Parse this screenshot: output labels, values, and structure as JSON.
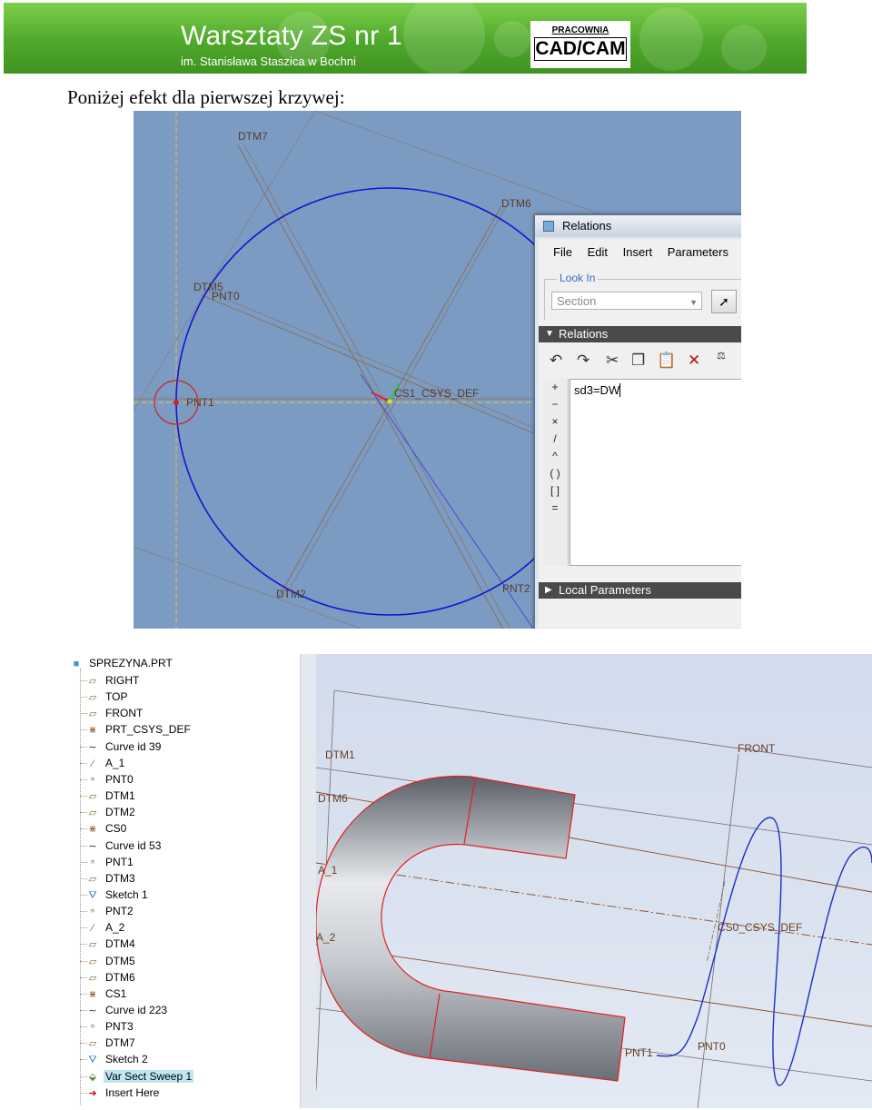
{
  "banner": {
    "title": "Warsztaty ZS nr 1",
    "subtitle": "im. Stanisława Staszica w Bochni",
    "badge_top": "PRACOWNIA",
    "badge_main": "CAD/CAM"
  },
  "caption": "Poniżej efekt dla pierwszej krzywej:",
  "viewport1": {
    "labels": [
      "DTM7",
      "DTM6",
      "DTM5",
      "PNT0",
      "CS1_CSYS_DEF",
      "PNT1",
      "DTM2",
      "PNT2"
    ]
  },
  "relations": {
    "title": "Relations",
    "menu": [
      "File",
      "Edit",
      "Insert",
      "Parameters"
    ],
    "look_in": "Look In",
    "section_placeholder": "Section",
    "relations_header": "Relations",
    "side_ops": [
      "+",
      "−",
      "×",
      "/",
      "^",
      "( )",
      "[ ]",
      "="
    ],
    "expression": "sd3=DW",
    "local_parameters": "Local Parameters",
    "colors": {
      "header": "#4a4a4a",
      "title_bar": "#c8d3e0"
    }
  },
  "model_tree": {
    "root": "SPREZYNA.PRT",
    "items": [
      {
        "label": "RIGHT",
        "icon": "datum-plane-icon"
      },
      {
        "label": "TOP",
        "icon": "datum-plane-icon"
      },
      {
        "label": "FRONT",
        "icon": "datum-plane-icon"
      },
      {
        "label": "PRT_CSYS_DEF",
        "icon": "csys-icon"
      },
      {
        "label": "Curve id 39",
        "icon": "curve-icon"
      },
      {
        "label": "A_1",
        "icon": "axis-icon"
      },
      {
        "label": "PNT0",
        "icon": "datum-point-icon"
      },
      {
        "label": "DTM1",
        "icon": "datum-plane-icon"
      },
      {
        "label": "DTM2",
        "icon": "datum-plane-icon"
      },
      {
        "label": "CS0",
        "icon": "csys-icon"
      },
      {
        "label": "Curve id 53",
        "icon": "curve-icon"
      },
      {
        "label": "PNT1",
        "icon": "datum-point-icon"
      },
      {
        "label": "DTM3",
        "icon": "datum-plane-icon"
      },
      {
        "label": "Sketch 1",
        "icon": "sketch-icon"
      },
      {
        "label": "PNT2",
        "icon": "datum-point-icon"
      },
      {
        "label": "A_2",
        "icon": "axis-icon"
      },
      {
        "label": "DTM4",
        "icon": "datum-plane-icon"
      },
      {
        "label": "DTM5",
        "icon": "datum-plane-icon"
      },
      {
        "label": "DTM6",
        "icon": "datum-plane-icon"
      },
      {
        "label": "CS1",
        "icon": "csys-icon"
      },
      {
        "label": "Curve id 223",
        "icon": "curve-icon"
      },
      {
        "label": "PNT3",
        "icon": "datum-point-icon"
      },
      {
        "label": "DTM7",
        "icon": "datum-plane-icon"
      },
      {
        "label": "Sketch 2",
        "icon": "sketch-icon"
      },
      {
        "label": "Var Sect Sweep 1",
        "icon": "sweep-icon",
        "selected": true
      },
      {
        "label": "Insert Here",
        "icon": "insert-arrow-icon"
      }
    ]
  },
  "viewport2": {
    "labels": [
      "DTM1",
      "FRONT",
      "DTM6",
      "A_1",
      "A_2",
      "CS0_CSYS_DEF",
      "PNT1",
      "PNT0"
    ]
  }
}
